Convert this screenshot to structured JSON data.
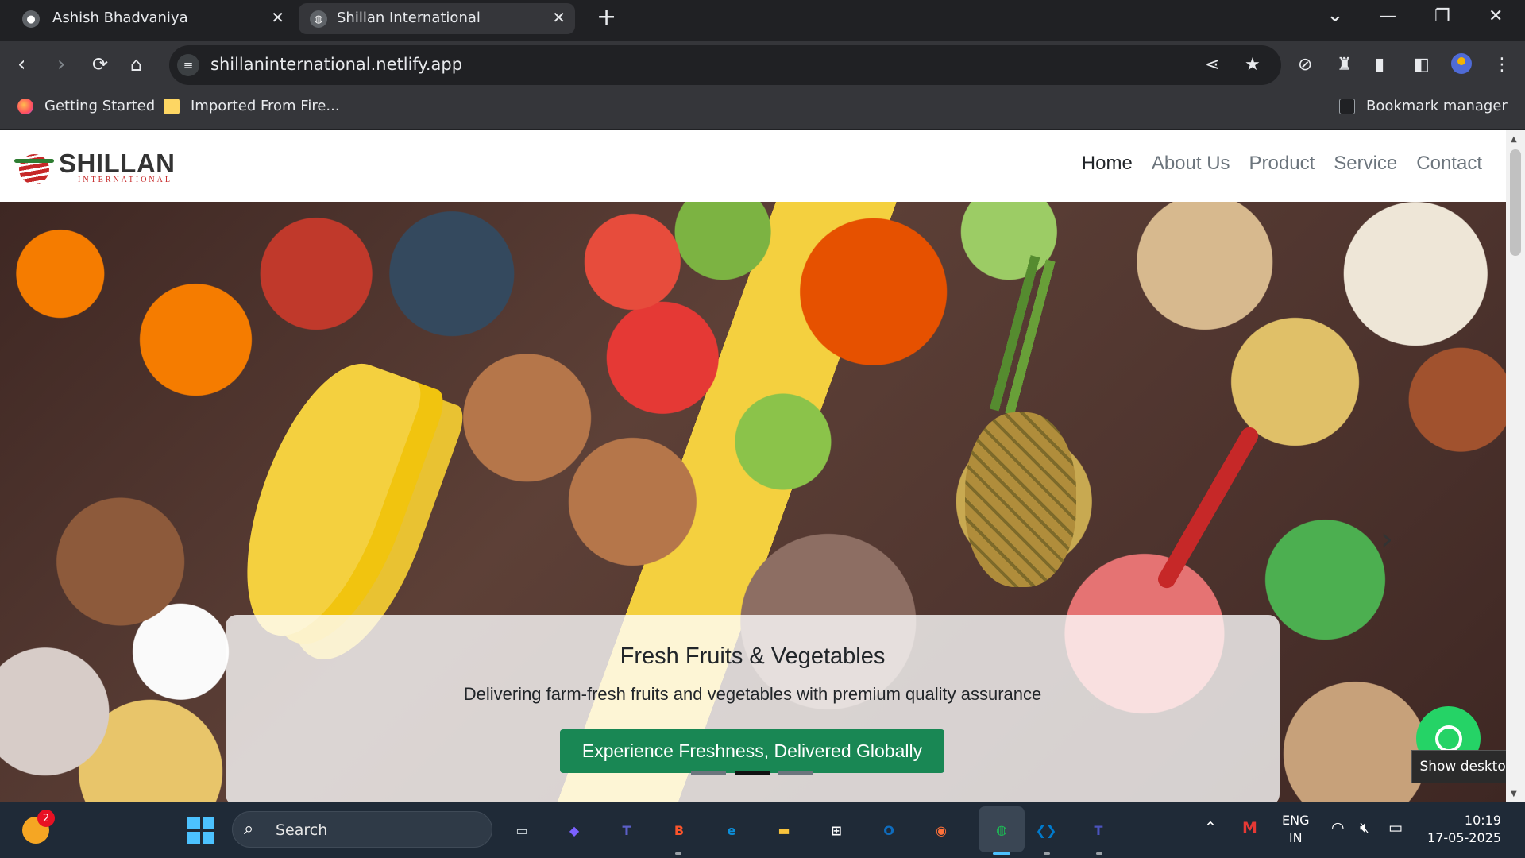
{
  "browser": {
    "tabs": [
      {
        "title": "Ashish Bhadvaniya",
        "close": "✕"
      },
      {
        "title": "Shillan International",
        "close": "✕"
      }
    ],
    "new_tab": "+",
    "window_controls": {
      "minimize": "—",
      "restore": "❐",
      "close": "✕",
      "tab_search": "⌄"
    },
    "url": "shillaninternational.netlify.app",
    "bookmarks": [
      {
        "label": "Getting Started"
      },
      {
        "label": "Imported From Fire..."
      }
    ],
    "bookmark_manager": "Bookmark manager"
  },
  "site": {
    "logo": {
      "name": "SHILLAN",
      "subtitle": "INTERNATIONAL"
    },
    "menu": [
      {
        "label": "Home",
        "active": true
      },
      {
        "label": "About Us"
      },
      {
        "label": "Product"
      },
      {
        "label": "Service"
      },
      {
        "label": "Contact"
      }
    ],
    "hero": {
      "title": "Fresh Fruits & Vegetables",
      "subtitle": "Delivering farm-fresh fruits and vegetables with premium quality assurance",
      "button": "Experience Freshness, Delivered Globally",
      "slides": 3,
      "active_slide": 2,
      "next_arrow": "›"
    },
    "tooltip": "Show desktop"
  },
  "taskbar": {
    "weather_badge": "2",
    "search_placeholder": "Search",
    "apps": [
      {
        "icon": "task-view-icon",
        "label": "▭",
        "color": "#cfd8dc"
      },
      {
        "icon": "copilot-icon",
        "label": "◆",
        "color": "#7b61ff"
      },
      {
        "icon": "teams-icon",
        "label": "T",
        "color": "#5b5fc7"
      },
      {
        "icon": "brave-icon",
        "label": "B",
        "color": "#fb542b"
      },
      {
        "icon": "edge-icon",
        "label": "e",
        "color": "#0c8ed9"
      },
      {
        "icon": "file-explorer-icon",
        "label": "▬",
        "color": "#f8c33c"
      },
      {
        "icon": "store-icon",
        "label": "⊞",
        "color": "#ffffff"
      },
      {
        "icon": "outlook-icon",
        "label": "O",
        "color": "#0f6cbd"
      },
      {
        "icon": "firefox-icon",
        "label": "◉",
        "color": "#ff7139"
      },
      {
        "icon": "chrome-app-icon",
        "label": "◍",
        "color": "#1db954"
      },
      {
        "icon": "vscode-icon",
        "label": "❮❯",
        "color": "#007acc"
      },
      {
        "icon": "teams-classic-icon",
        "label": "T",
        "color": "#4b53bc"
      }
    ],
    "language": {
      "line1": "ENG",
      "line2": "IN"
    },
    "time": "10:19",
    "date": "17-05-2025"
  }
}
